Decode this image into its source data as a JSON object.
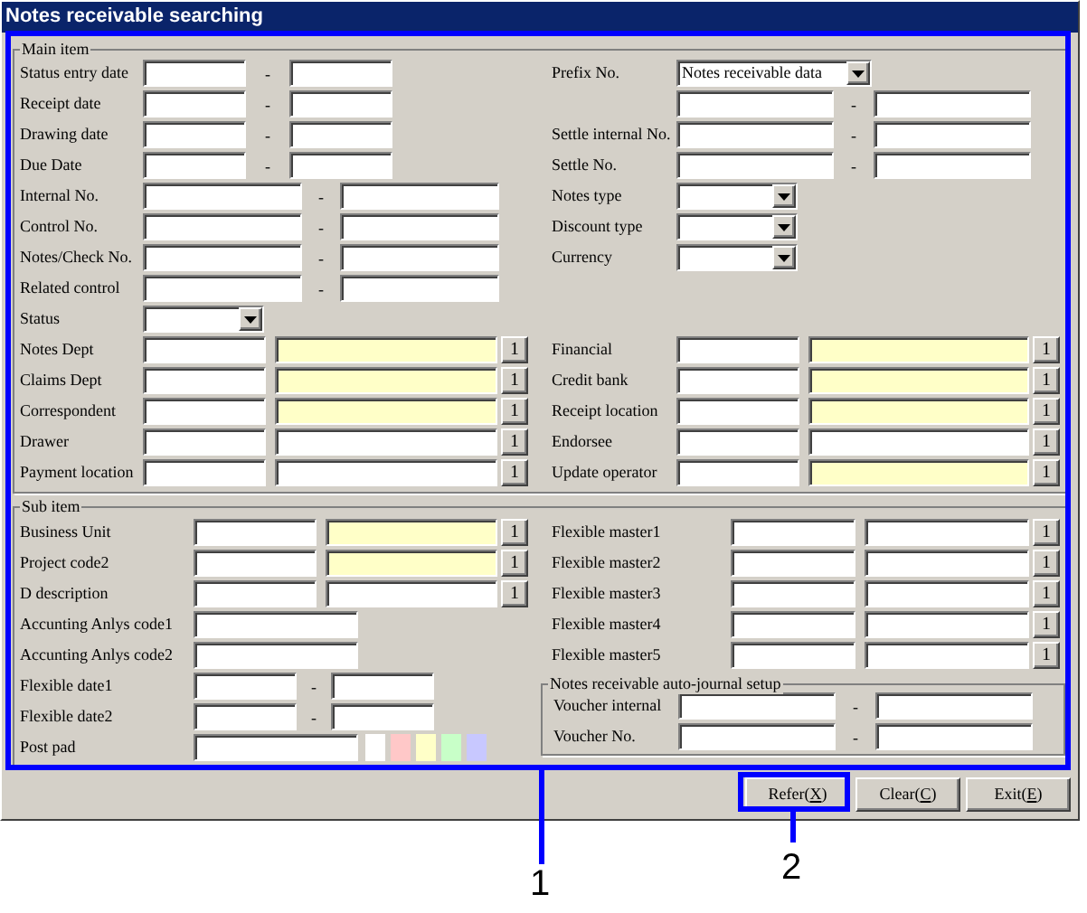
{
  "window": {
    "title": "Notes receivable searching"
  },
  "main_item": {
    "title": "Main item",
    "left": [
      {
        "kind": "date_range",
        "label": "Status entry date",
        "separator": "-"
      },
      {
        "kind": "date_range",
        "label": "Receipt date",
        "separator": "-"
      },
      {
        "kind": "date_range",
        "label": "Drawing date",
        "separator": "-"
      },
      {
        "kind": "date_range",
        "label": "Due Date",
        "separator": "-"
      },
      {
        "kind": "range",
        "label": "Internal No.",
        "separator": "-"
      },
      {
        "kind": "range",
        "label": "Control No.",
        "separator": "-"
      },
      {
        "kind": "range",
        "label": "Notes/Check No.",
        "separator": "-"
      },
      {
        "kind": "range",
        "label": "Related control",
        "separator": "-"
      },
      {
        "kind": "combo",
        "label": "Status"
      },
      {
        "kind": "lookup",
        "label": "Notes Dept",
        "highlighted": true,
        "button": "1"
      },
      {
        "kind": "lookup",
        "label": "Claims Dept",
        "highlighted": true,
        "button": "1"
      },
      {
        "kind": "lookup",
        "label": "Correspondent",
        "highlighted": true,
        "button": "1"
      },
      {
        "kind": "lookup",
        "label": "Drawer",
        "highlighted": false,
        "button": "1"
      },
      {
        "kind": "lookup",
        "label": "Payment location",
        "highlighted": false,
        "button": "1"
      }
    ],
    "right_upper": [
      {
        "kind": "combo",
        "label": "Prefix No.",
        "value": "Notes receivable data"
      },
      {
        "kind": "range",
        "separator": "-"
      },
      {
        "kind": "range",
        "label": "Settle internal No.",
        "separator": "-"
      },
      {
        "kind": "range",
        "label": "Settle No.",
        "separator": "-"
      },
      {
        "kind": "combo",
        "label": "Notes type"
      },
      {
        "kind": "combo",
        "label": "Discount type"
      },
      {
        "kind": "combo",
        "label": "Currency"
      }
    ],
    "right_lower": [
      {
        "kind": "lookup",
        "label": "Financial",
        "highlighted": true,
        "button": "1"
      },
      {
        "kind": "lookup",
        "label": "Credit bank",
        "highlighted": true,
        "button": "1"
      },
      {
        "kind": "lookup",
        "label": "Receipt location",
        "highlighted": true,
        "button": "1"
      },
      {
        "kind": "lookup",
        "label": "Endorsee",
        "highlighted": false,
        "button": "1"
      },
      {
        "kind": "lookup",
        "label": "Update operator",
        "highlighted": true,
        "button": "1"
      }
    ]
  },
  "sub_item": {
    "title": "Sub item",
    "left": [
      {
        "kind": "lookup",
        "label": "Business Unit",
        "highlighted": true,
        "button": "1"
      },
      {
        "kind": "lookup",
        "label": "Project code2",
        "highlighted": true,
        "button": "1"
      },
      {
        "kind": "lookup",
        "label": "D description",
        "highlighted": false,
        "button": "1"
      },
      {
        "kind": "single",
        "label": "Accunting Anlys code1"
      },
      {
        "kind": "single",
        "label": "Accunting Anlys code2"
      },
      {
        "kind": "date_range",
        "label": "Flexible date1",
        "separator": "-"
      },
      {
        "kind": "date_range",
        "label": "Flexible date2",
        "separator": "-"
      },
      {
        "kind": "postpad",
        "label": "Post pad",
        "swatches": [
          {
            "color": "#ffffff"
          },
          {
            "color": "#ffc8c8"
          },
          {
            "color": "#ffffc8"
          },
          {
            "color": "#c8ffc8"
          },
          {
            "color": "#c8c8ff"
          }
        ]
      }
    ],
    "right": [
      {
        "kind": "lookup",
        "label": "Flexible master1",
        "highlighted": false,
        "button": "1"
      },
      {
        "kind": "lookup",
        "label": "Flexible master2",
        "highlighted": false,
        "button": "1"
      },
      {
        "kind": "lookup",
        "label": "Flexible master3",
        "highlighted": false,
        "button": "1"
      },
      {
        "kind": "lookup",
        "label": "Flexible master4",
        "highlighted": false,
        "button": "1"
      },
      {
        "kind": "lookup",
        "label": "Flexible master5",
        "highlighted": false,
        "button": "1"
      }
    ],
    "journal": {
      "title": "Notes receivable auto-journal setup",
      "rows": [
        {
          "kind": "range",
          "label": "Voucher internal",
          "separator": "-"
        },
        {
          "kind": "range",
          "label": "Voucher No.",
          "separator": "-"
        }
      ]
    }
  },
  "buttons": [
    {
      "before": "Refer(",
      "key": "X",
      "after": ")"
    },
    {
      "before": "Clear(",
      "key": "C",
      "after": ")"
    },
    {
      "before": "Exit(",
      "key": "E",
      "after": ")"
    }
  ],
  "callouts": [
    {
      "number": "1"
    },
    {
      "number": "2"
    }
  ]
}
